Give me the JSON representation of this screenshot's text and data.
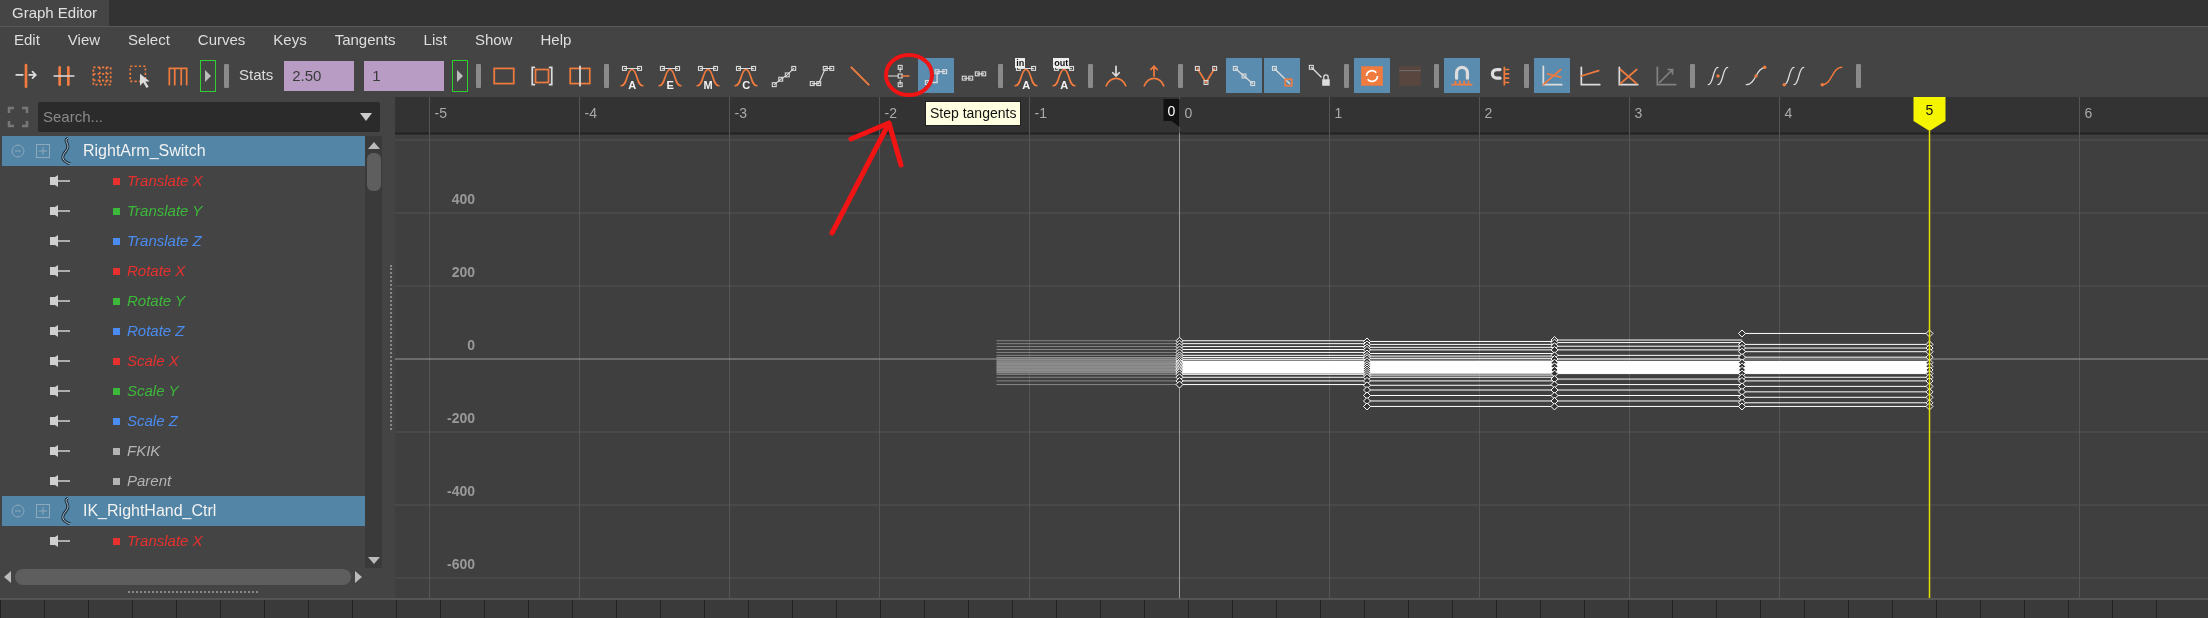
{
  "window": {
    "title": "Graph Editor"
  },
  "menu": [
    "Edit",
    "View",
    "Select",
    "Curves",
    "Keys",
    "Tangents",
    "List",
    "Show",
    "Help"
  ],
  "toolbar": [
    {
      "kind": "tool",
      "selected": false,
      "disabled": false
    },
    {
      "kind": "tool",
      "selected": false,
      "disabled": false
    },
    {
      "kind": "tool",
      "selected": false,
      "disabled": false
    },
    {
      "kind": "tool",
      "selected": false,
      "disabled": false
    },
    {
      "kind": "tool",
      "selected": false,
      "disabled": false
    },
    {
      "kind": "expander"
    },
    {
      "kind": "separator"
    },
    {
      "kind": "label",
      "text": "Stats"
    },
    {
      "kind": "field",
      "value": "2.50"
    },
    {
      "kind": "field",
      "value": "1"
    },
    {
      "kind": "expander"
    },
    {
      "kind": "separator"
    },
    {
      "kind": "tool",
      "selected": false,
      "disabled": false
    },
    {
      "kind": "tool",
      "selected": false,
      "disabled": false
    },
    {
      "kind": "tool",
      "selected": false,
      "disabled": false
    },
    {
      "kind": "separator"
    },
    {
      "kind": "tool",
      "selected": false,
      "disabled": false,
      "letter": "A"
    },
    {
      "kind": "tool",
      "selected": false,
      "disabled": false,
      "letter": "E"
    },
    {
      "kind": "tool",
      "selected": false,
      "disabled": false,
      "letter": "M"
    },
    {
      "kind": "tool",
      "selected": false,
      "disabled": false,
      "letter": "C"
    },
    {
      "kind": "tool",
      "selected": false,
      "disabled": false
    },
    {
      "kind": "tool",
      "selected": false,
      "disabled": false
    },
    {
      "kind": "tool",
      "selected": false,
      "disabled": false
    },
    {
      "kind": "tool",
      "selected": false,
      "disabled": false
    },
    {
      "kind": "tool",
      "selected": true,
      "disabled": false
    },
    {
      "kind": "tool",
      "selected": false,
      "disabled": false
    },
    {
      "kind": "separator"
    },
    {
      "kind": "tool",
      "selected": false,
      "disabled": false,
      "tag": "in",
      "letter": "A"
    },
    {
      "kind": "tool",
      "selected": false,
      "disabled": false,
      "tag": "out",
      "letter": "A"
    },
    {
      "kind": "separator"
    },
    {
      "kind": "tool",
      "selected": false,
      "disabled": false
    },
    {
      "kind": "tool",
      "selected": false,
      "disabled": false
    },
    {
      "kind": "separator"
    },
    {
      "kind": "tool",
      "selected": false,
      "disabled": false
    },
    {
      "kind": "tool",
      "selected": true,
      "disabled": false
    },
    {
      "kind": "tool",
      "selected": true,
      "disabled": false
    },
    {
      "kind": "tool",
      "selected": false,
      "disabled": false
    },
    {
      "kind": "separator"
    },
    {
      "kind": "tool",
      "selected": true,
      "disabled": false
    },
    {
      "kind": "tool",
      "selected": false,
      "disabled": true
    },
    {
      "kind": "separator"
    },
    {
      "kind": "tool",
      "selected": true,
      "disabled": false
    },
    {
      "kind": "tool",
      "selected": false,
      "disabled": false
    },
    {
      "kind": "separator"
    },
    {
      "kind": "tool",
      "selected": true,
      "disabled": false
    },
    {
      "kind": "tool",
      "selected": false,
      "disabled": false
    },
    {
      "kind": "tool",
      "selected": false,
      "disabled": false
    },
    {
      "kind": "tool",
      "selected": false,
      "disabled": true
    },
    {
      "kind": "separator"
    },
    {
      "kind": "tool",
      "selected": false,
      "disabled": false
    },
    {
      "kind": "tool",
      "selected": false,
      "disabled": false
    },
    {
      "kind": "tool",
      "selected": false,
      "disabled": false
    },
    {
      "kind": "tool",
      "selected": false,
      "disabled": false
    },
    {
      "kind": "separator"
    }
  ],
  "tooltip": {
    "text": "Step tangents"
  },
  "outliner": {
    "search": {
      "placeholder": "Search..."
    },
    "nodes": [
      {
        "name": "RightArm_Switch",
        "selected": true,
        "children": [
          {
            "name": "Translate X",
            "color": "#e8302e"
          },
          {
            "name": "Translate Y",
            "color": "#3cb83a"
          },
          {
            "name": "Translate Z",
            "color": "#4a8cf0"
          },
          {
            "name": "Rotate X",
            "color": "#e8302e"
          },
          {
            "name": "Rotate Y",
            "color": "#3cb83a"
          },
          {
            "name": "Rotate Z",
            "color": "#4a8cf0"
          },
          {
            "name": "Scale X",
            "color": "#e8302e"
          },
          {
            "name": "Scale Y",
            "color": "#3cb83a"
          },
          {
            "name": "Scale Z",
            "color": "#4a8cf0"
          },
          {
            "name": "FKIK",
            "color": "#b4b4b4"
          },
          {
            "name": "Parent",
            "color": "#b4b4b4"
          }
        ]
      },
      {
        "name": "IK_RightHand_Ctrl",
        "selected": true,
        "children": [
          {
            "name": "Translate X",
            "color": "#e8302e"
          }
        ]
      }
    ]
  },
  "graph": {
    "frame_labels": [
      "-5",
      "-4",
      "-3",
      "-2",
      "-1",
      "0",
      "1",
      "2",
      "3",
      "4",
      "6"
    ],
    "value_labels": [
      "400",
      "200",
      "0",
      "-200",
      "-400",
      "-600"
    ],
    "range_start": "0",
    "current_frame": "5"
  }
}
